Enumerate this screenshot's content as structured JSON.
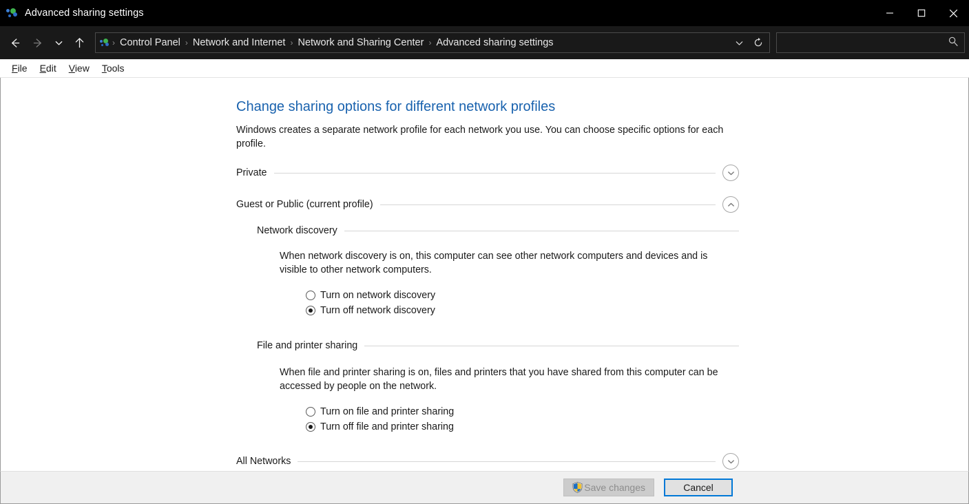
{
  "window": {
    "title": "Advanced sharing settings",
    "icon": "network-sharing-icon",
    "controls": {
      "minimize": "minimize-icon",
      "maximize": "maximize-icon",
      "close": "close-icon"
    }
  },
  "nav": {
    "back": "back-arrow-icon",
    "forward": "forward-arrow-icon",
    "recent": "chevron-down-icon",
    "up": "up-arrow-icon",
    "dropdown": "address-dropdown-icon",
    "refresh": "refresh-icon",
    "breadcrumbs": [
      "Control Panel",
      "Network and Internet",
      "Network and Sharing Center",
      "Advanced sharing settings"
    ],
    "separator": "›"
  },
  "search": {
    "value": "",
    "placeholder": "",
    "icon": "search-icon"
  },
  "menubar": {
    "items": [
      {
        "accel": "F",
        "rest": "ile"
      },
      {
        "accel": "E",
        "rest": "dit"
      },
      {
        "accel": "V",
        "rest": "iew"
      },
      {
        "accel": "T",
        "rest": "ools"
      }
    ]
  },
  "main": {
    "heading": "Change sharing options for different network profiles",
    "description": "Windows creates a separate network profile for each network you use. You can choose specific options for each profile.",
    "profiles": [
      {
        "name": "Private",
        "expanded": false,
        "chevron": "chevron-down-icon"
      },
      {
        "name": "Guest or Public (current profile)",
        "expanded": true,
        "chevron": "chevron-up-icon",
        "sections": [
          {
            "title": "Network discovery",
            "description": "When network discovery is on, this computer can see other network computers and devices and is visible to other network computers.",
            "options": [
              {
                "label": "Turn on network discovery",
                "selected": false
              },
              {
                "label": "Turn off network discovery",
                "selected": true
              }
            ]
          },
          {
            "title": "File and printer sharing",
            "description": "When file and printer sharing is on, files and printers that you have shared from this computer can be accessed by people on the network.",
            "options": [
              {
                "label": "Turn on file and printer sharing",
                "selected": false
              },
              {
                "label": "Turn off file and printer sharing",
                "selected": true
              }
            ]
          }
        ]
      },
      {
        "name": "All Networks",
        "expanded": false,
        "chevron": "chevron-down-icon"
      }
    ]
  },
  "footer": {
    "save_label": "Save changes",
    "save_enabled": false,
    "save_icon": "uac-shield-icon",
    "cancel_label": "Cancel",
    "cancel_focused": true
  },
  "colors": {
    "titlebar_bg": "#000000",
    "navbar_bg": "#191919",
    "heading_blue": "#1962ae",
    "focus_blue": "#0078d7",
    "footer_bg": "#f0f0f0",
    "rule_gray": "#d6d6d6"
  }
}
